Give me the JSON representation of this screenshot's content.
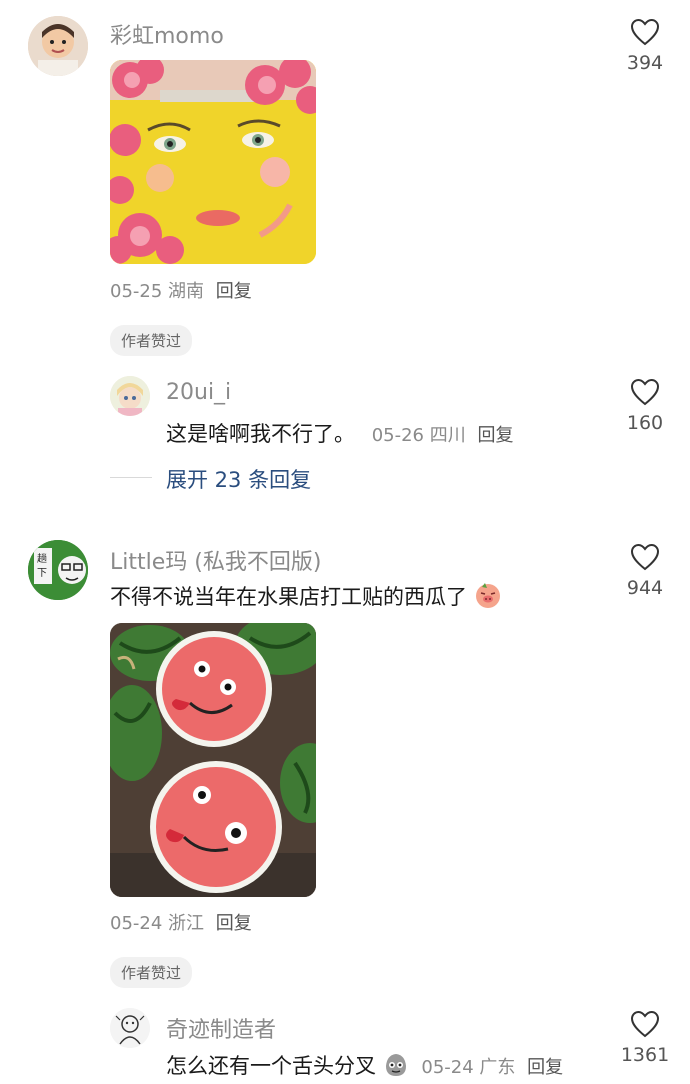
{
  "comments": [
    {
      "username": "彩虹momo",
      "likes": "394",
      "date": "05-25",
      "location": "湖南",
      "reply_label": "回复",
      "author_badge": "作者赞过",
      "replies": [
        {
          "username": "20ui_i",
          "text": "这是啥啊我不行了。",
          "date": "05-26",
          "location": "四川",
          "reply_label": "回复",
          "likes": "160"
        }
      ],
      "expand_label": "展开 23 条回复"
    },
    {
      "username": "Little玛 (私我不回版)",
      "text": "不得不说当年在水果店打工贴的西瓜了",
      "likes": "944",
      "date": "05-24",
      "location": "浙江",
      "reply_label": "回复",
      "author_badge": "作者赞过",
      "replies": [
        {
          "username": "奇迹制造者",
          "text": "怎么还有一个舌头分叉",
          "date": "05-24",
          "location": "广东",
          "reply_label": "回复",
          "likes": "1361"
        }
      ]
    }
  ],
  "icons": {
    "like": "heart-outline-icon",
    "emoji_pig": "pig-face-emoji-icon",
    "emoji_skull": "dizzy-emoji-icon"
  }
}
